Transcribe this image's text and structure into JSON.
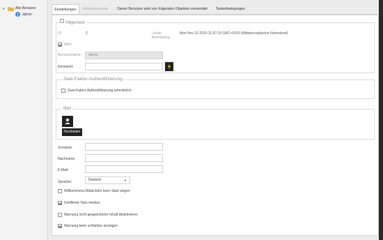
{
  "sidebar": {
    "toggle": "▾",
    "root_label": "Alle Benutzer",
    "child_label": "admin"
  },
  "tabs": [
    {
      "label": "Einstellungen"
    },
    {
      "label": "Arbeitsbereiche"
    },
    {
      "label": "Dieser Benutzer wird von folgenden Objekten verwendet"
    },
    {
      "label": "Tastenbelegungen"
    }
  ],
  "general": {
    "legend": "Allgemein",
    "id_label": "ID:",
    "id_value": "2",
    "last_login_label": "Letzte Anmeldung:",
    "last_login_value": "Mon Nov 16 2020 11:57:18 GMT+0100 (Mitteleuropäische Normalzeit)",
    "active_label": "Aktiv",
    "active_checked": true,
    "username_label": "Benutzername:",
    "username_value": "admin",
    "password_label": "Kennwort:",
    "password_value": ""
  },
  "twofactor": {
    "legend": "Zwei-Faktor-Authentifizierung",
    "required_label": "Zwei-Faktor-Authentifizierung erforderlich",
    "required_checked": false
  },
  "picture": {
    "legend": "Bild",
    "upload_label": "Hochladen"
  },
  "personal": {
    "firstname_label": "Vorname:",
    "firstname_value": "",
    "lastname_label": "Nachname:",
    "lastname_value": "",
    "email_label": "E-Mail:",
    "email_value": "",
    "language_label": "Sprache:",
    "language_value": "Deutsch"
  },
  "options": [
    {
      "label": "Willkommens-Bildschirm beim Start zeigen",
      "checked": false
    },
    {
      "label": "Geöffnete Tabs merken",
      "checked": true
    },
    {
      "label": "Warnung nicht gespeicherter Inhalt deaktivieren",
      "checked": false
    },
    {
      "label": "Warnung beim schließen anzeigen",
      "checked": true
    }
  ],
  "colors": {
    "accent": "#f5c518",
    "user_icon": "#1e73d2",
    "folder": "#e8b84a",
    "dark_button": "#222222"
  }
}
